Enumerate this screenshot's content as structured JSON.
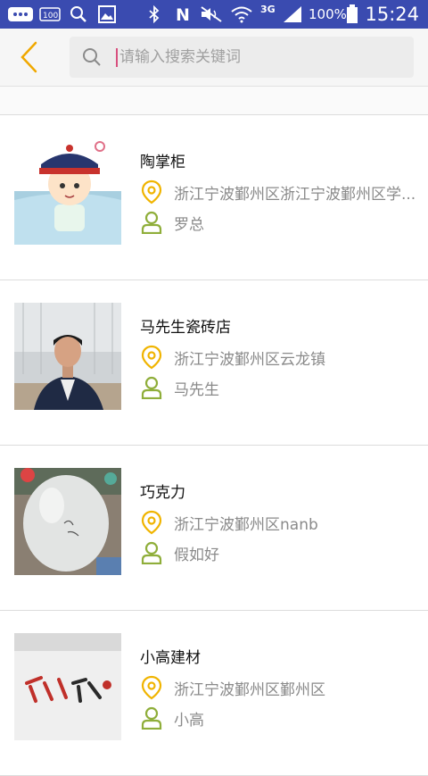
{
  "status_bar": {
    "battery_percent": "100%",
    "time": "15:24",
    "network": "3G",
    "icons": [
      "message-icon",
      "battery-saver-icon",
      "search-icon",
      "image-icon",
      "bluetooth-icon",
      "nfc-icon",
      "mute-icon",
      "wifi-icon",
      "signal-icon",
      "battery-icon"
    ]
  },
  "header": {
    "back_icon": "chevron-left-icon",
    "search_placeholder": "请输入搜索关键词",
    "accent_color": "#f0a800"
  },
  "results": [
    {
      "name": "陶掌柜",
      "address": "浙江宁波鄞州区浙江宁波鄞州区学...",
      "contact": "罗总",
      "thumb": "cartoon-emperor"
    },
    {
      "name": "马先生瓷砖店",
      "address": "浙江宁波鄞州区云龙镇",
      "contact": "马先生",
      "thumb": "man-photo"
    },
    {
      "name": "巧克力",
      "address": "浙江宁波鄞州区nanb",
      "contact": "假如好",
      "thumb": "balloon-photo"
    },
    {
      "name": "小高建材",
      "address": "浙江宁波鄞州区鄞州区",
      "contact": "小高",
      "thumb": "banner-photo"
    }
  ],
  "colors": {
    "location_icon": "#f0b400",
    "person_icon": "#8fae3a",
    "status_bar": "#3a4bb0"
  }
}
